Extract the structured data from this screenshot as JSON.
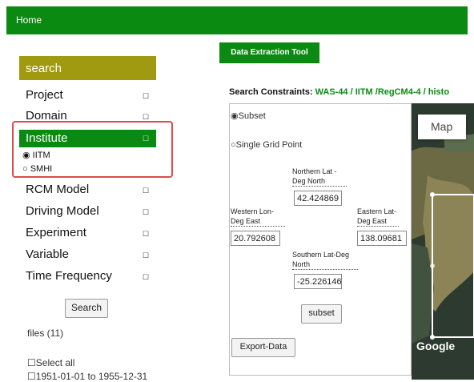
{
  "nav": {
    "home": "Home"
  },
  "sidebar": {
    "header": "search",
    "items": [
      {
        "label": "Project",
        "box": "☐"
      },
      {
        "label": "Domain",
        "box": "☐"
      },
      {
        "label": "Institute",
        "box": "☐"
      },
      {
        "label": "RCM Model",
        "box": "☐"
      },
      {
        "label": "Driving Model",
        "box": "☐"
      },
      {
        "label": "Experiment",
        "box": "☐"
      },
      {
        "label": "Variable",
        "box": "☐"
      },
      {
        "label": "Time Frequency",
        "box": "☐"
      }
    ],
    "institute_options": [
      {
        "label": "IITM",
        "selected": true
      },
      {
        "label": "SMHI",
        "selected": false
      }
    ],
    "search_button": "Search",
    "files": "files (11)",
    "select_all": "Select all",
    "first_file": "1951-01-01 to 1955-12-31"
  },
  "main": {
    "tool_button": "Data Extraction Tool",
    "constraints_label": "Search Constraints:",
    "constraints_value": "WAS-44 / IITM /RegCM4-4 / histo",
    "subset_option": "Subset",
    "single_option": "Single Grid Point",
    "northern_label": "Northern Lat - Deg North",
    "northern_value": "42.424869",
    "western_label": "Western Lon- Deg East",
    "western_value": "20.792608",
    "eastern_label": "Eastern Lat- Deg East",
    "eastern_value": "138.09681",
    "southern_label": "Southern Lat-Deg North",
    "southern_value": "-25.226146",
    "subset_button": "subset",
    "export_button": "Export-Data"
  },
  "map": {
    "tab": "Map",
    "logo": "Google"
  },
  "colors": {
    "green": "#0b8a12",
    "olive": "#a09a11",
    "highlight": "#e04a4a"
  }
}
